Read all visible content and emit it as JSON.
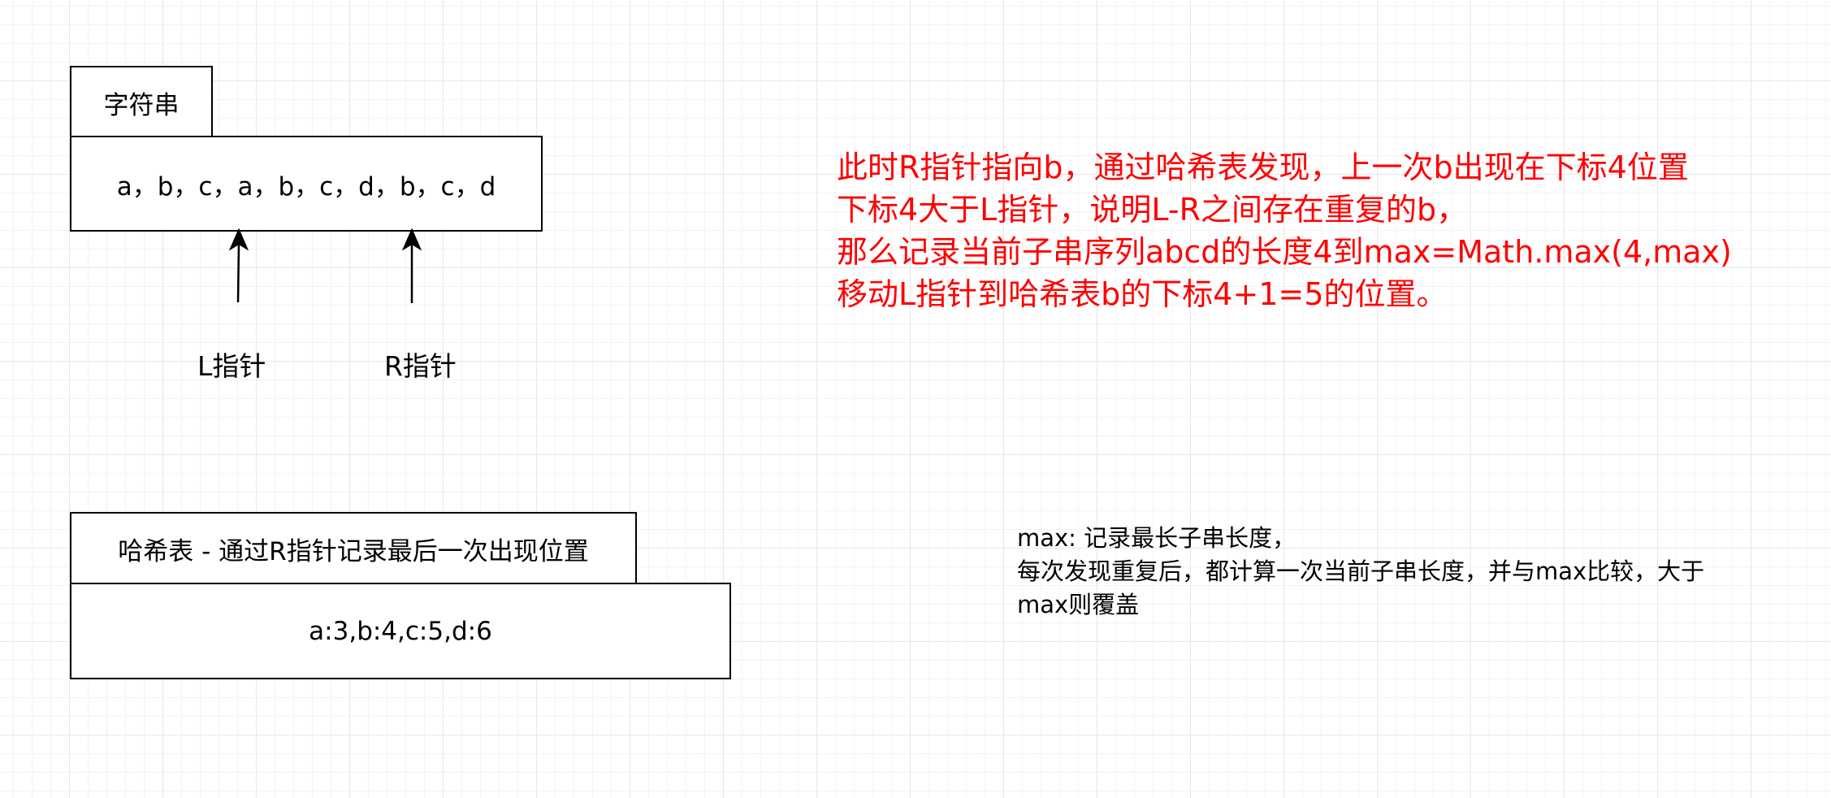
{
  "string_box": {
    "tab_label": "字符串",
    "content": "a，b，c，a，b，c，d，b，c，d"
  },
  "pointers": {
    "left_label": "L指针",
    "right_label": "R指针"
  },
  "hash_box": {
    "tab_label": "哈希表 - 通过R指针记录最后一次出现位置",
    "content": "a:3,b:4,c:5,d:6"
  },
  "red_note": {
    "color": "#ff0000",
    "lines": [
      "此时R指针指向b，通过哈希表发现，上一次b出现在下标4位置",
      "下标4大于L指针，说明L-R之间存在重复的b，",
      "那么记录当前子串序列abcd的长度4到max=Math.max(4,max)",
      "移动L指针到哈希表b的下标4+1=5的位置。"
    ]
  },
  "black_note": {
    "lines": [
      "max: 记录最长子串长度，",
      "每次发现重复后，都计算一次当前子串长度，并与max比较，大于",
      "max则覆盖"
    ]
  }
}
